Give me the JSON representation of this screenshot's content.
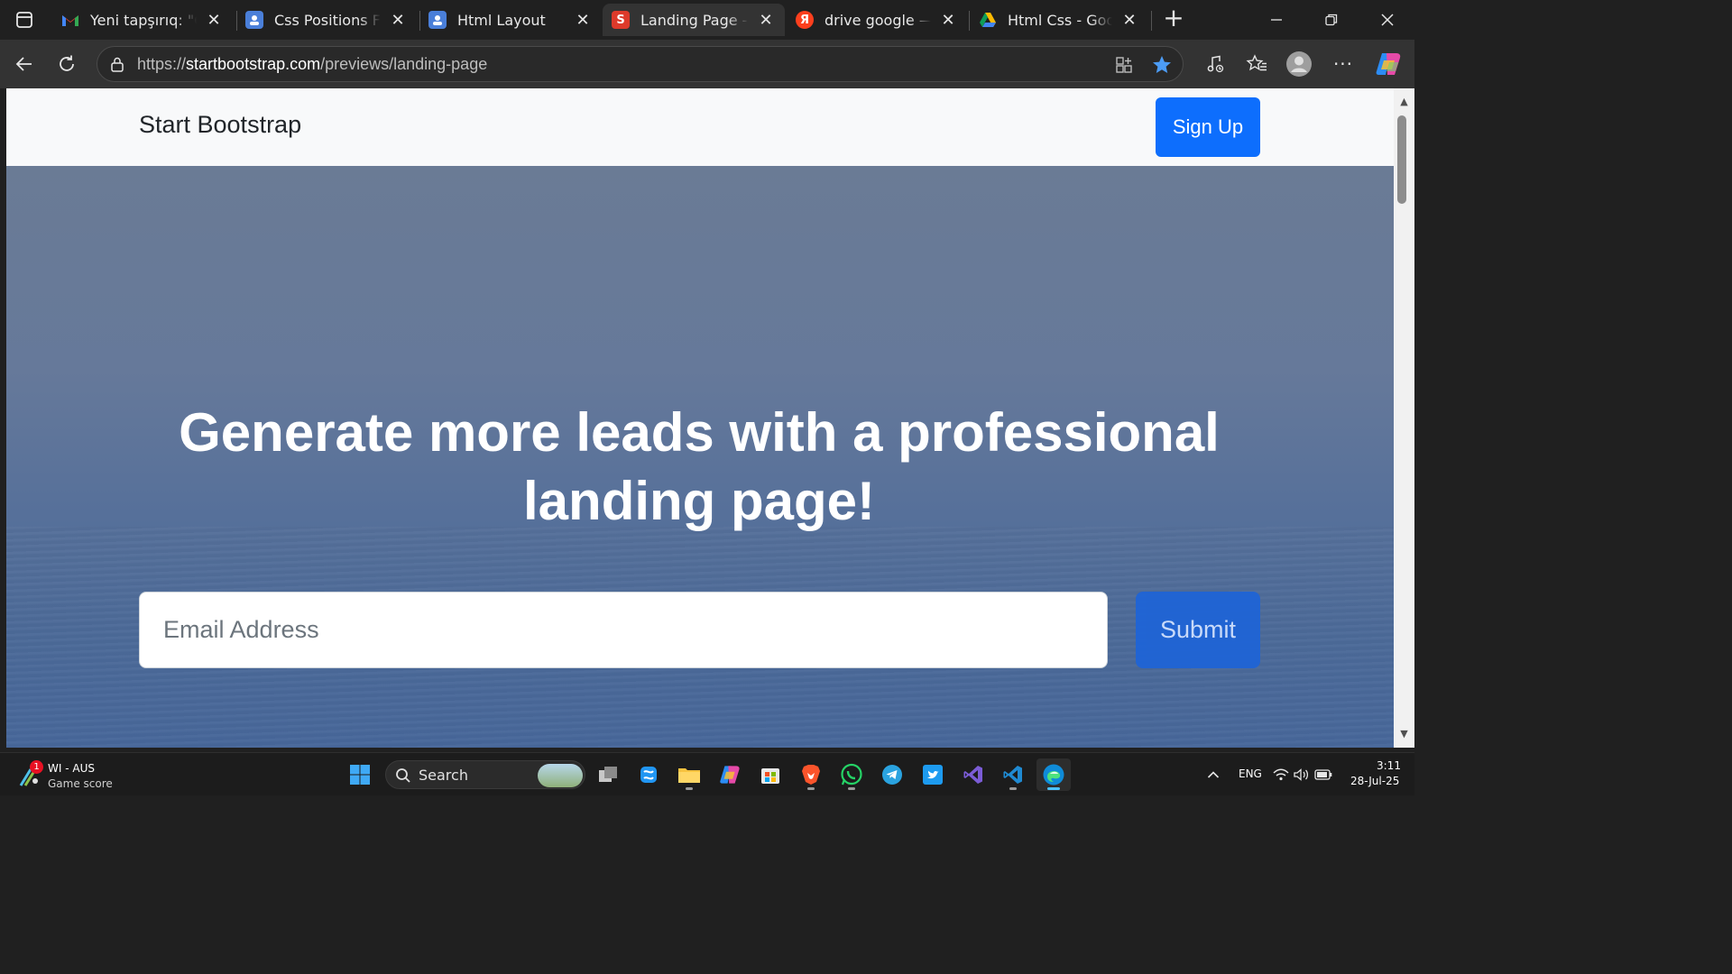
{
  "browser": {
    "tabs": [
      {
        "title": "Yeni tapşırıq: \"Css",
        "favicon": "gmail-icon",
        "active": false
      },
      {
        "title": "Css Positions Flex",
        "favicon": "classroom-icon",
        "active": false
      },
      {
        "title": "Html Layout",
        "favicon": "classroom-icon",
        "active": false
      },
      {
        "title": "Landing Page - Th",
        "favicon": "startbootstrap-icon",
        "active": true
      },
      {
        "title": "drive google — Я",
        "favicon": "yandex-icon",
        "active": false
      },
      {
        "title": "Html Css - Googl",
        "favicon": "google-drive-icon",
        "active": false
      }
    ],
    "url_prefix": "https://",
    "url_host": "startbootstrap.com",
    "url_path": "/previews/landing-page"
  },
  "page": {
    "brand": "Start Bootstrap",
    "signup_label": "Sign Up",
    "headline": "Generate more leads with a professional landing page!",
    "email_placeholder": "Email Address",
    "email_value": "",
    "submit_label": "Submit"
  },
  "taskbar": {
    "weather_title": "WI - AUS",
    "weather_subtitle": "Game score",
    "weather_badge": "1",
    "search_label": "Search",
    "language": "ENG",
    "time": "3:11",
    "date": "28-Jul-25"
  },
  "colors": {
    "primary": "#0d6efd",
    "hero_top": "#6a7b95",
    "hero_bottom": "#47679a",
    "browser_dark": "#202020"
  }
}
